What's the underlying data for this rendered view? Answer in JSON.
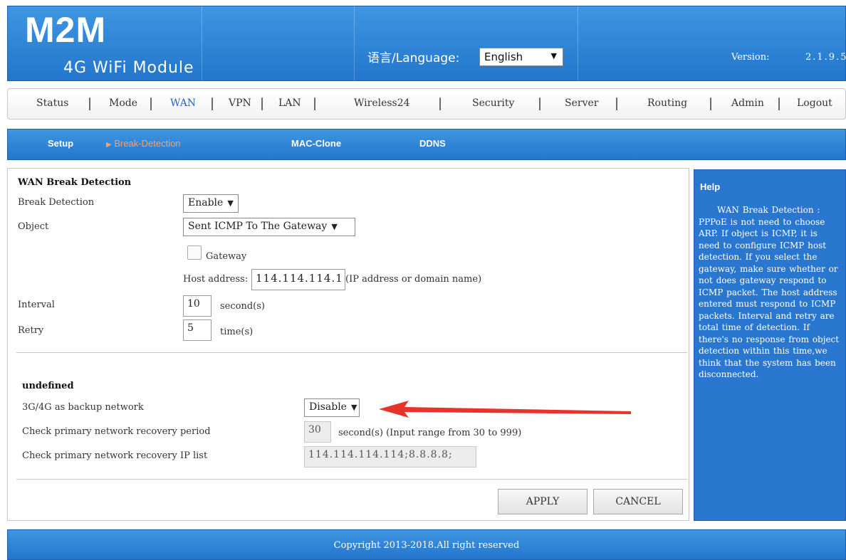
{
  "header": {
    "logo": "M2M",
    "subtitle": "4G WiFi Module",
    "language_label": "语言/Language:",
    "language_value": "English",
    "version_label": "Version:",
    "version_value": "2.1.9.5"
  },
  "main_nav": {
    "items": [
      "Status",
      "Mode",
      "WAN",
      "VPN",
      "LAN",
      "Wireless24",
      "Security",
      "Server",
      "Routing",
      "Admin",
      "Logout"
    ],
    "active": "WAN"
  },
  "sub_nav": {
    "items": [
      "Setup",
      "Break-Detection",
      "MAC-Clone",
      "DDNS"
    ],
    "active": "Break-Detection"
  },
  "break_detection": {
    "section_title": "WAN Break Detection",
    "break_detection_label": "Break Detection",
    "break_detection_value": "Enable",
    "object_label": "Object",
    "object_value": "Sent ICMP To The Gateway",
    "gateway_checkbox_label": "Gateway",
    "gateway_checked": false,
    "host_address_label": "Host address:",
    "host_address_value": "114.114.114.1",
    "host_address_hint": "(IP address or domain name)",
    "interval_label": "Interval",
    "interval_value": "10",
    "interval_unit": "second(s)",
    "retry_label": "Retry",
    "retry_value": "5",
    "retry_unit": "time(s)"
  },
  "backup": {
    "section_title": "undefined",
    "backup_label": "3G/4G as backup network",
    "backup_value": "Disable",
    "period_label": "Check primary network recovery period",
    "period_value": "30",
    "period_hint": "second(s) (Input range from 30 to 999)",
    "ip_list_label": "Check primary network recovery IP list",
    "ip_list_value": "114.114.114.114;8.8.8.8;"
  },
  "buttons": {
    "apply": "APPLY",
    "cancel": "CANCEL"
  },
  "help": {
    "title": "Help",
    "text": "WAN Break Detection : PPPoE is not need to choose ARP. If object is ICMP, it is need to configure ICMP host detection. If you select the gateway, make sure whether or not does gateway respond to ICMP packet. The host address entered must respond to ICMP packets. Interval and retry are total time of detection. If there's no response from object detection within this time,we think that the system has been disconnected."
  },
  "footer": {
    "copyright": "Copyright 2013-2018.All right reserved"
  },
  "colors": {
    "header_blue": "#2a7fd6",
    "active_subnav": "#f4a36a",
    "annotation_arrow": "#e8322c"
  }
}
